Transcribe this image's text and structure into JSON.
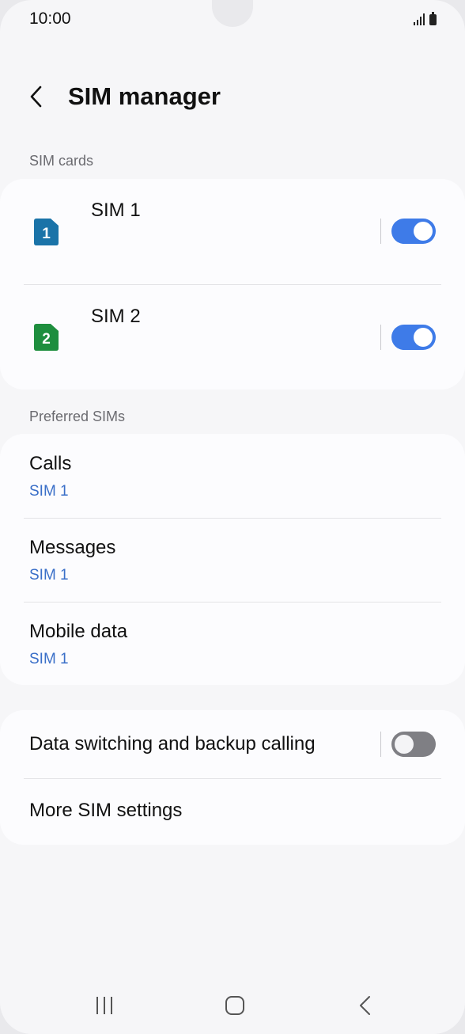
{
  "status_bar": {
    "time": "10:00",
    "signal_icon": "signal-bars-icon",
    "battery_icon": "battery-icon"
  },
  "header": {
    "back_icon": "chevron-left-icon",
    "title": "SIM manager"
  },
  "sim_cards": {
    "section_label": "SIM cards",
    "items": [
      {
        "name": "SIM 1",
        "badge": "1",
        "badge_color": "#1a73a8",
        "enabled": true
      },
      {
        "name": "SIM 2",
        "badge": "2",
        "badge_color": "#1e8e3e",
        "enabled": true
      }
    ]
  },
  "preferred_sims": {
    "section_label": "Preferred SIMs",
    "items": [
      {
        "title": "Calls",
        "value": "SIM 1"
      },
      {
        "title": "Messages",
        "value": "SIM 1"
      },
      {
        "title": "Mobile data",
        "value": "SIM 1"
      }
    ]
  },
  "other_settings": {
    "data_switching": {
      "label": "Data switching and backup calling",
      "enabled": false
    },
    "more_settings": {
      "label": "More SIM settings"
    }
  },
  "nav_bar": {
    "recents_icon": "recents-icon",
    "home_icon": "home-icon",
    "back_icon": "back-icon"
  },
  "colors": {
    "accent": "#3e7be8",
    "value_text": "#3a6fc8",
    "toggle_off": "#7f7f84",
    "background": "#f6f6f8",
    "card": "#fcfcfe"
  }
}
